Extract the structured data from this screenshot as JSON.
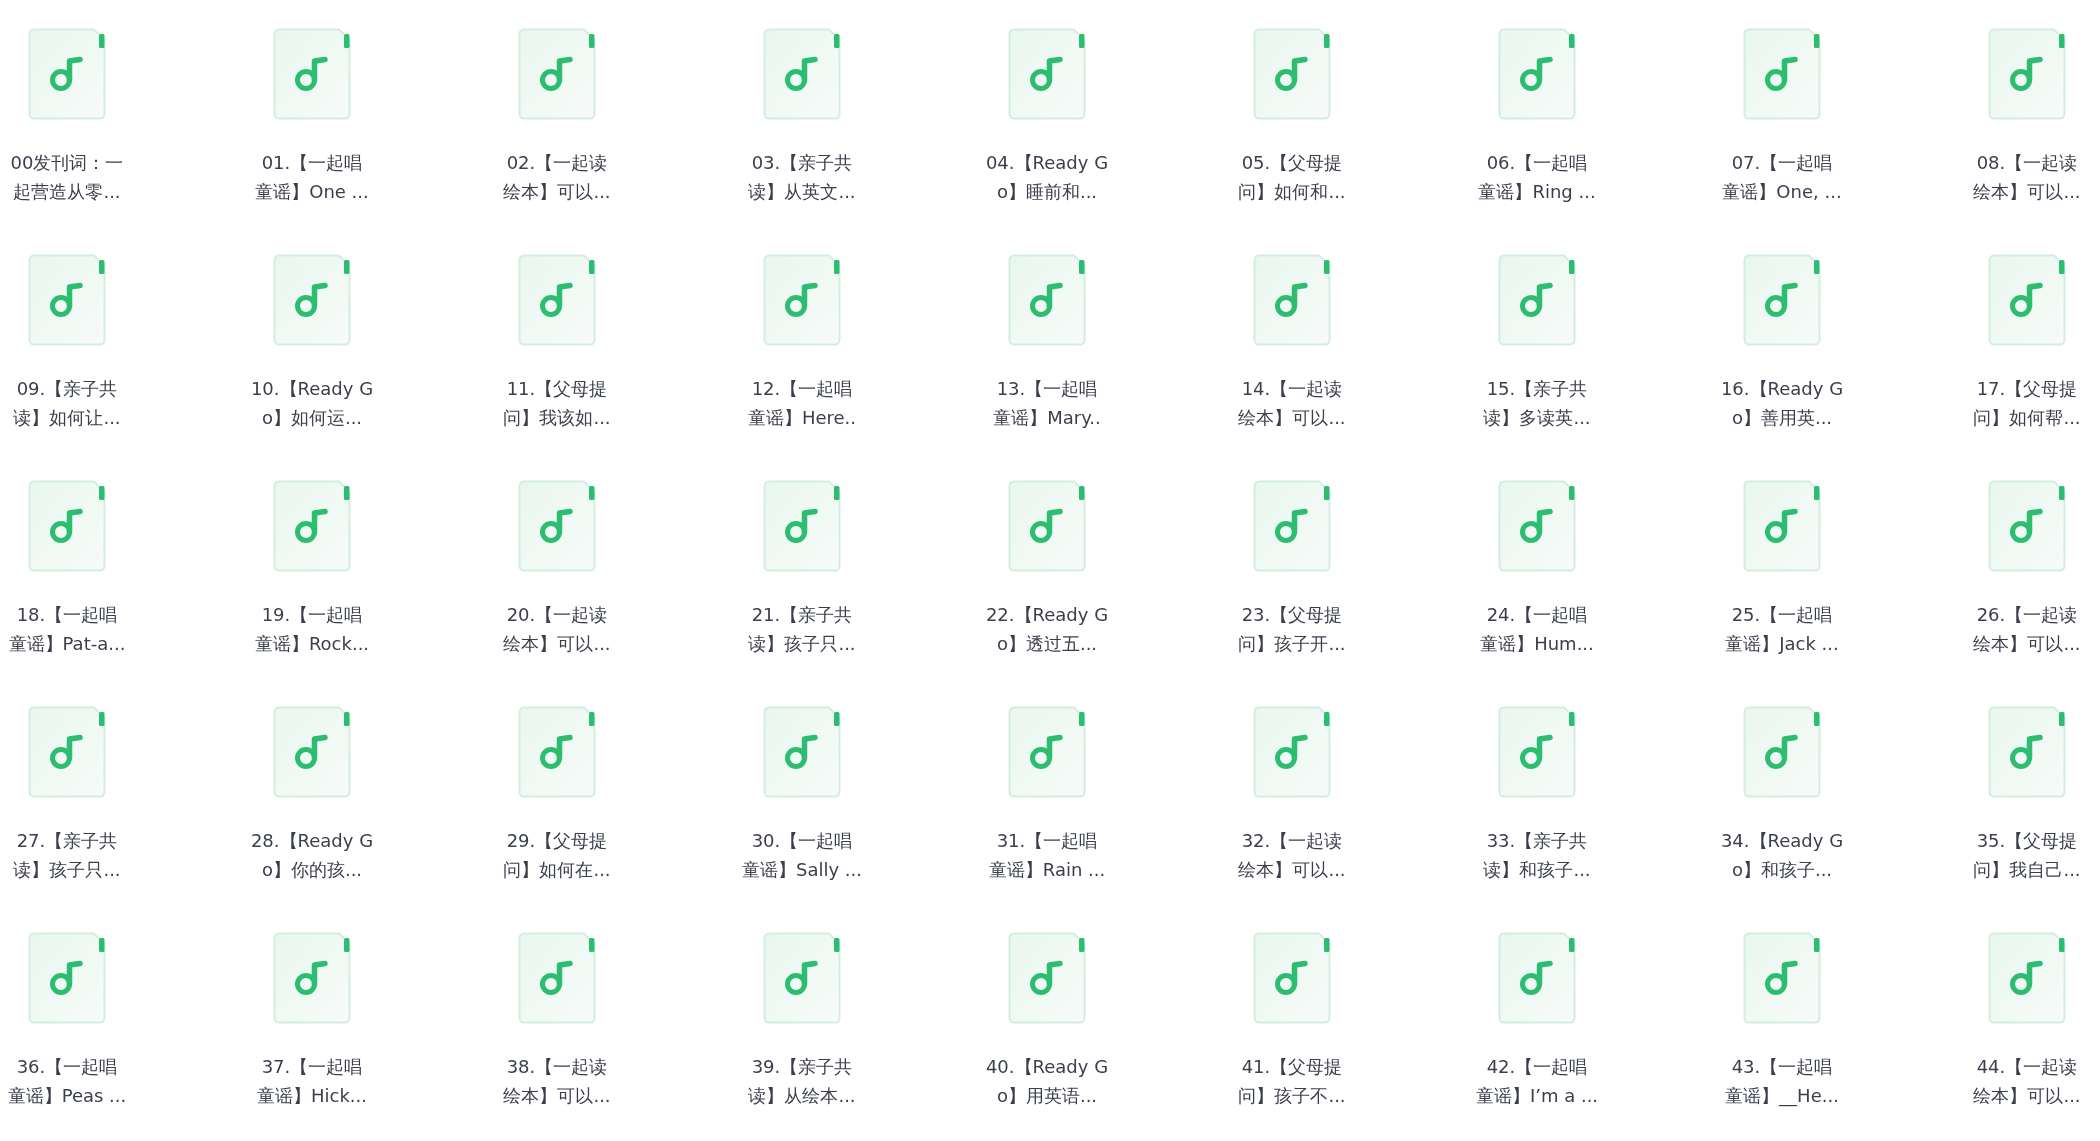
{
  "files": [
    {
      "lines": [
        "00发刊词：一",
        "起营造从零..."
      ]
    },
    {
      "lines": [
        "01.【一起唱",
        "童谣】One ..."
      ]
    },
    {
      "lines": [
        "02.【一起读",
        "绘本】可以..."
      ]
    },
    {
      "lines": [
        "03.【亲子共",
        "读】从英文..."
      ]
    },
    {
      "lines": [
        "04.【Ready G",
        "o】睡前和..."
      ]
    },
    {
      "lines": [
        "05.【父母提",
        "问】如何和..."
      ]
    },
    {
      "lines": [
        "06.【一起唱",
        "童谣】Ring ..."
      ]
    },
    {
      "lines": [
        "07.【一起唱",
        "童谣】One, ..."
      ]
    },
    {
      "lines": [
        "08.【一起读",
        "绘本】可以..."
      ]
    },
    {
      "lines": [
        "09.【亲子共",
        "读】如何让..."
      ]
    },
    {
      "lines": [
        "10.【Ready G",
        "o】如何运..."
      ]
    },
    {
      "lines": [
        "11.【父母提",
        "问】我该如..."
      ]
    },
    {
      "lines": [
        "12.【一起唱",
        "童谣】Here.."
      ]
    },
    {
      "lines": [
        "13.【一起唱",
        "童谣】Mary.."
      ]
    },
    {
      "lines": [
        "14.【一起读",
        "绘本】可以..."
      ]
    },
    {
      "lines": [
        "15.【亲子共",
        "读】多读英..."
      ]
    },
    {
      "lines": [
        "16.【Ready G",
        "o】善用英..."
      ]
    },
    {
      "lines": [
        "17.【父母提",
        "问】如何帮..."
      ]
    },
    {
      "lines": [
        "18.【一起唱",
        "童谣】Pat-a..."
      ]
    },
    {
      "lines": [
        "19.【一起唱",
        "童谣】Rock..."
      ]
    },
    {
      "lines": [
        "20.【一起读",
        "绘本】可以..."
      ]
    },
    {
      "lines": [
        "21.【亲子共",
        "读】孩子只..."
      ]
    },
    {
      "lines": [
        "22.【Ready G",
        "o】透过五..."
      ]
    },
    {
      "lines": [
        "23.【父母提",
        "问】孩子开..."
      ]
    },
    {
      "lines": [
        "24.【一起唱",
        "童谣】Hum..."
      ]
    },
    {
      "lines": [
        "25.【一起唱",
        "童谣】Jack ..."
      ]
    },
    {
      "lines": [
        "26.【一起读",
        "绘本】可以..."
      ]
    },
    {
      "lines": [
        "27.【亲子共",
        "读】孩子只..."
      ]
    },
    {
      "lines": [
        "28.【Ready G",
        "o】你的孩..."
      ]
    },
    {
      "lines": [
        "29.【父母提",
        "问】如何在..."
      ]
    },
    {
      "lines": [
        "30.【一起唱",
        "童谣】Sally ..."
      ]
    },
    {
      "lines": [
        "31.【一起唱",
        "童谣】Rain ..."
      ]
    },
    {
      "lines": [
        "32.【一起读",
        "绘本】可以..."
      ]
    },
    {
      "lines": [
        "33.【亲子共",
        "读】和孩子..."
      ]
    },
    {
      "lines": [
        "34.【Ready G",
        "o】和孩子..."
      ]
    },
    {
      "lines": [
        "35.【父母提",
        "问】我自己..."
      ]
    },
    {
      "lines": [
        "36.【一起唱",
        "童谣】Peas ..."
      ]
    },
    {
      "lines": [
        "37.【一起唱",
        "童谣】Hick..."
      ]
    },
    {
      "lines": [
        "38.【一起读",
        "绘本】可以..."
      ]
    },
    {
      "lines": [
        "39.【亲子共",
        "读】从绘本..."
      ]
    },
    {
      "lines": [
        "40.【Ready G",
        "o】用英语..."
      ]
    },
    {
      "lines": [
        "41.【父母提",
        "问】孩子不..."
      ]
    },
    {
      "lines": [
        "42.【一起唱",
        "童谣】I’m a ..."
      ]
    },
    {
      "lines": [
        "43.【一起唱",
        "童谣】__He..."
      ]
    },
    {
      "lines": [
        "44.【一起读",
        "绘本】可以..."
      ]
    }
  ]
}
